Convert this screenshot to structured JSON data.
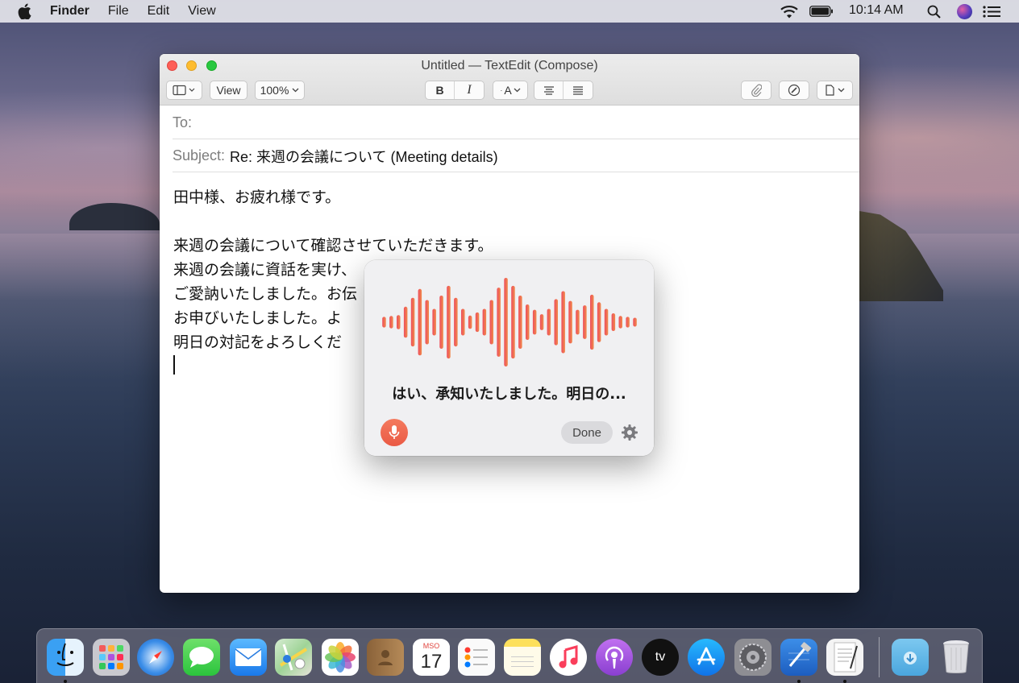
{
  "menubar": {
    "app_name": "Finder",
    "items": [
      "File",
      "Edit",
      "View"
    ],
    "clock": "10:14 AM"
  },
  "window": {
    "title": "Untitled — TextEdit (Compose)",
    "toolbar": {
      "view_label": "View",
      "zoom_label": "100%",
      "bold_label": "B",
      "italic_label": "I",
      "font_color_label": "A"
    },
    "to_label": "To:",
    "to_value": "",
    "subject_label": "Subject:",
    "subject_value": "Re: 来週の会議について (Meeting details)",
    "body_lines": [
      "田中様、お疲れ様です。",
      "",
      "来週の会議について確認させていただきます。",
      "来週の会議に資話を実け、",
      "ご愛訥いたしました。お伝",
      "お申びいたしました。よ",
      "明日の対記をよろしくだ"
    ]
  },
  "dictation": {
    "transcript": "はい、承知いたしました。明日の...",
    "done_label": "Done",
    "wave_colors": [
      "#ee4e5e",
      "#f08a4a"
    ],
    "wave_levels": [
      0.12,
      0.14,
      0.16,
      0.35,
      0.55,
      0.75,
      0.5,
      0.3,
      0.6,
      0.82,
      0.55,
      0.3,
      0.15,
      0.22,
      0.3,
      0.5,
      0.78,
      1.0,
      0.82,
      0.6,
      0.4,
      0.28,
      0.18,
      0.3,
      0.52,
      0.7,
      0.48,
      0.28,
      0.38,
      0.62,
      0.45,
      0.3,
      0.2,
      0.14,
      0.12,
      0.1
    ]
  },
  "dock": {
    "apps": [
      {
        "name": "finder-icon",
        "running": true
      },
      {
        "name": "launchpad-icon",
        "running": false
      },
      {
        "name": "safari-icon",
        "running": false
      },
      {
        "name": "messages-icon",
        "running": false
      },
      {
        "name": "mail-icon",
        "running": false
      },
      {
        "name": "maps-icon",
        "running": false
      },
      {
        "name": "photos-icon",
        "running": false
      },
      {
        "name": "contacts-icon",
        "running": false
      },
      {
        "name": "calendar-icon",
        "running": false
      },
      {
        "name": "reminders-icon",
        "running": false
      },
      {
        "name": "notes-icon",
        "running": false
      },
      {
        "name": "music-icon",
        "running": false
      },
      {
        "name": "podcasts-icon",
        "running": false
      },
      {
        "name": "tv-icon",
        "running": false
      },
      {
        "name": "app-store-icon",
        "running": false
      },
      {
        "name": "system-preferences-icon",
        "running": false
      },
      {
        "name": "xcode-icon",
        "running": true
      },
      {
        "name": "textedit-icon",
        "running": true
      }
    ],
    "calendar_month": "MSO",
    "calendar_day": "17",
    "tv_label": "tv"
  }
}
